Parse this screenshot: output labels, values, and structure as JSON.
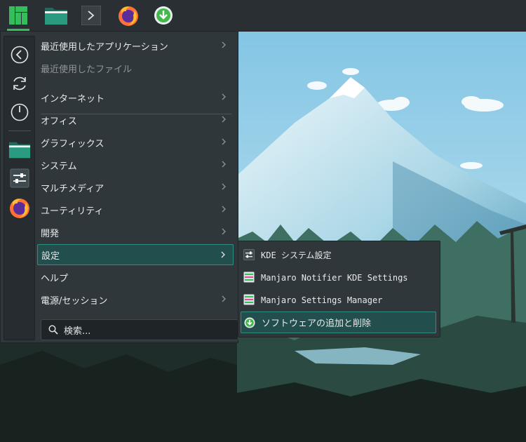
{
  "panel": {
    "apps": [
      {
        "icon": "manjaro-logo-icon",
        "active": true
      },
      {
        "icon": "folder-icon"
      },
      {
        "icon": "terminal-icon"
      },
      {
        "icon": "firefox-icon"
      },
      {
        "icon": "software-install-icon"
      }
    ]
  },
  "sidebar": {
    "items": [
      {
        "icon": "back-icon"
      },
      {
        "icon": "restart-icon"
      },
      {
        "icon": "power-icon"
      },
      {
        "icon": "folder-icon"
      },
      {
        "icon": "settings-icon"
      },
      {
        "icon": "firefox-icon"
      }
    ]
  },
  "menu": {
    "items": [
      {
        "label": "最近使用したアプリケーション",
        "submenu": true
      },
      {
        "label": "最近使用したファイル",
        "disabled": true
      },
      {
        "label": "インターネット",
        "submenu": true
      },
      {
        "label": "オフィス",
        "submenu": true
      },
      {
        "label": "グラフィックス",
        "submenu": true
      },
      {
        "label": "システム",
        "submenu": true
      },
      {
        "label": "マルチメディア",
        "submenu": true
      },
      {
        "label": "ユーティリティ",
        "submenu": true
      },
      {
        "label": "開発",
        "submenu": true
      },
      {
        "label": "設定",
        "submenu": true,
        "selected": true
      },
      {
        "label": "ヘルプ"
      },
      {
        "label": "電源/セッション",
        "submenu": true
      }
    ]
  },
  "search": {
    "placeholder": "検索..."
  },
  "submenu": {
    "items": [
      {
        "label": "KDE システム設定",
        "icon": "settings-icon"
      },
      {
        "label": "Manjaro Notifier KDE Settings",
        "icon": "manjaro-settings-icon"
      },
      {
        "label": "Manjaro Settings Manager",
        "icon": "manjaro-settings-icon"
      },
      {
        "label": "ソフトウェアの追加と削除",
        "icon": "software-install-icon",
        "selected": true
      }
    ]
  },
  "colors": {
    "accent": "#35bf5c",
    "selection": "#234e4e",
    "menu_bg": "#30373b"
  }
}
